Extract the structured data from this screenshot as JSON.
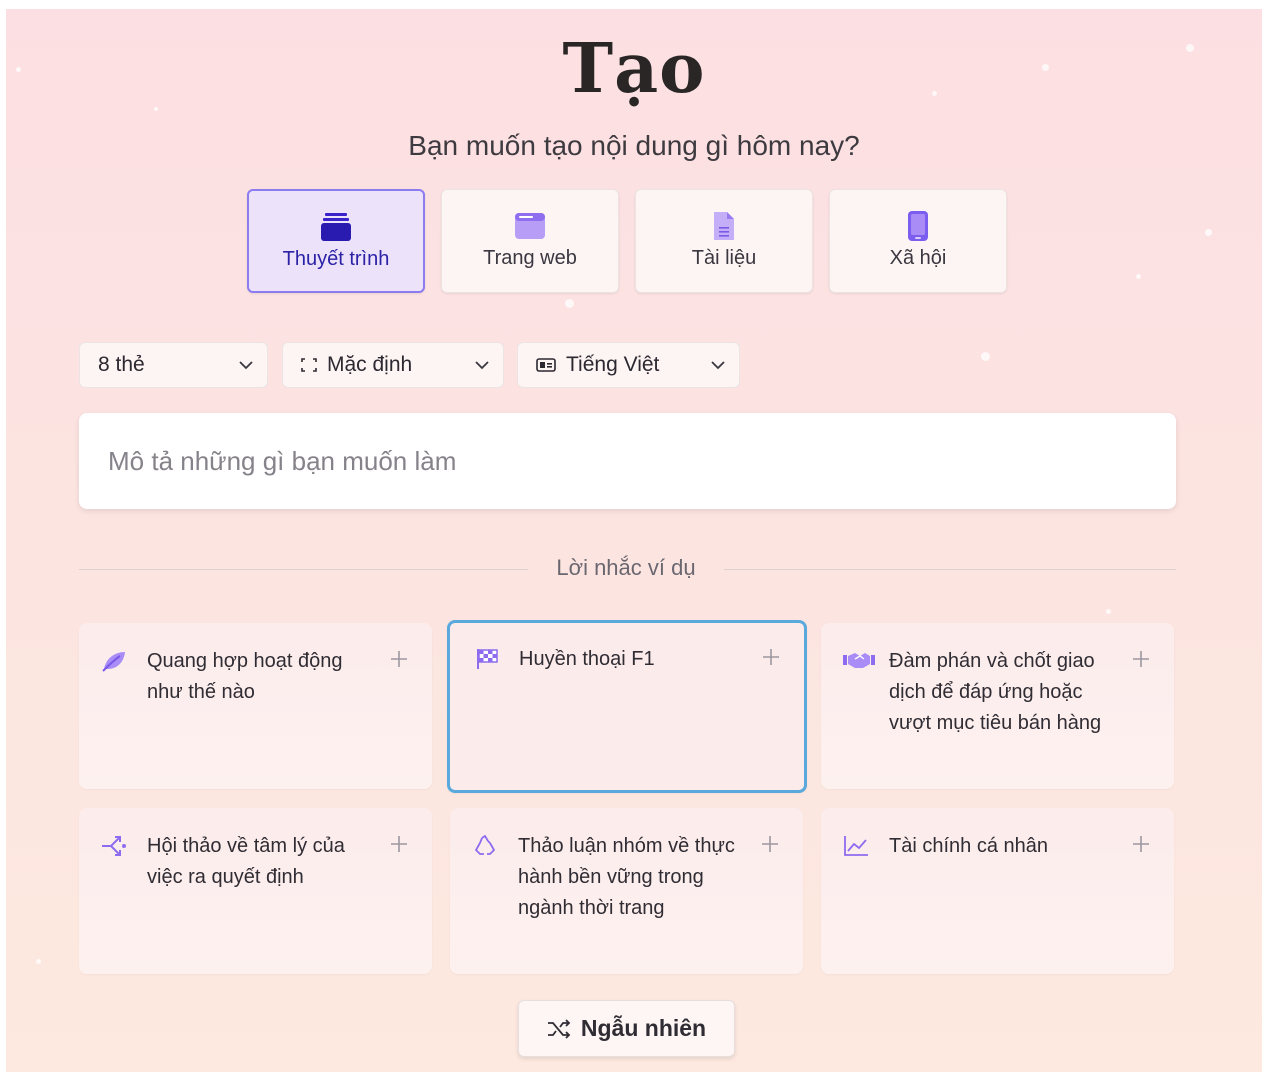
{
  "page": {
    "title": "Tạo",
    "subtitle": "Bạn muốn tạo nội dung gì hôm nay?"
  },
  "content_types": [
    {
      "label": "Thuyết trình",
      "icon": "presentation-icon",
      "active": true
    },
    {
      "label": "Trang web",
      "icon": "webpage-icon",
      "active": false
    },
    {
      "label": "Tài liệu",
      "icon": "document-icon",
      "active": false
    },
    {
      "label": "Xã hội",
      "icon": "mobile-social-icon",
      "active": false
    }
  ],
  "options": {
    "cards": "8 thẻ",
    "aspect": "Mặc định",
    "language": "Tiếng Việt"
  },
  "prompt": {
    "placeholder": "Mô tả những gì bạn muốn làm",
    "value": ""
  },
  "examples": {
    "heading": "Lời nhắc ví dụ",
    "items": [
      {
        "text": "Quang hợp hoạt động như thế nào",
        "icon": "leaf-icon"
      },
      {
        "text": "Huyền thoại F1",
        "icon": "checkered-flag-icon"
      },
      {
        "text": "Đàm phán và chốt giao dịch để đáp ứng hoặc vượt mục tiêu bán hàng",
        "icon": "handshake-icon"
      },
      {
        "text": "Hội thảo về tâm lý của việc ra quyết định",
        "icon": "branch-arrows-icon"
      },
      {
        "text": "Thảo luận nhóm về thực hành bền vững trong ngành thời trang",
        "icon": "recycle-icon"
      },
      {
        "text": "Tài chính cá nhân",
        "icon": "line-chart-icon"
      }
    ]
  },
  "shuffle_label": "Ngẫu nhiên",
  "colors": {
    "accent": "#8d7bf0",
    "active_label": "#2c22a6",
    "icon_purple": "#9b6cf0",
    "focus_border": "#5aa9dc"
  }
}
